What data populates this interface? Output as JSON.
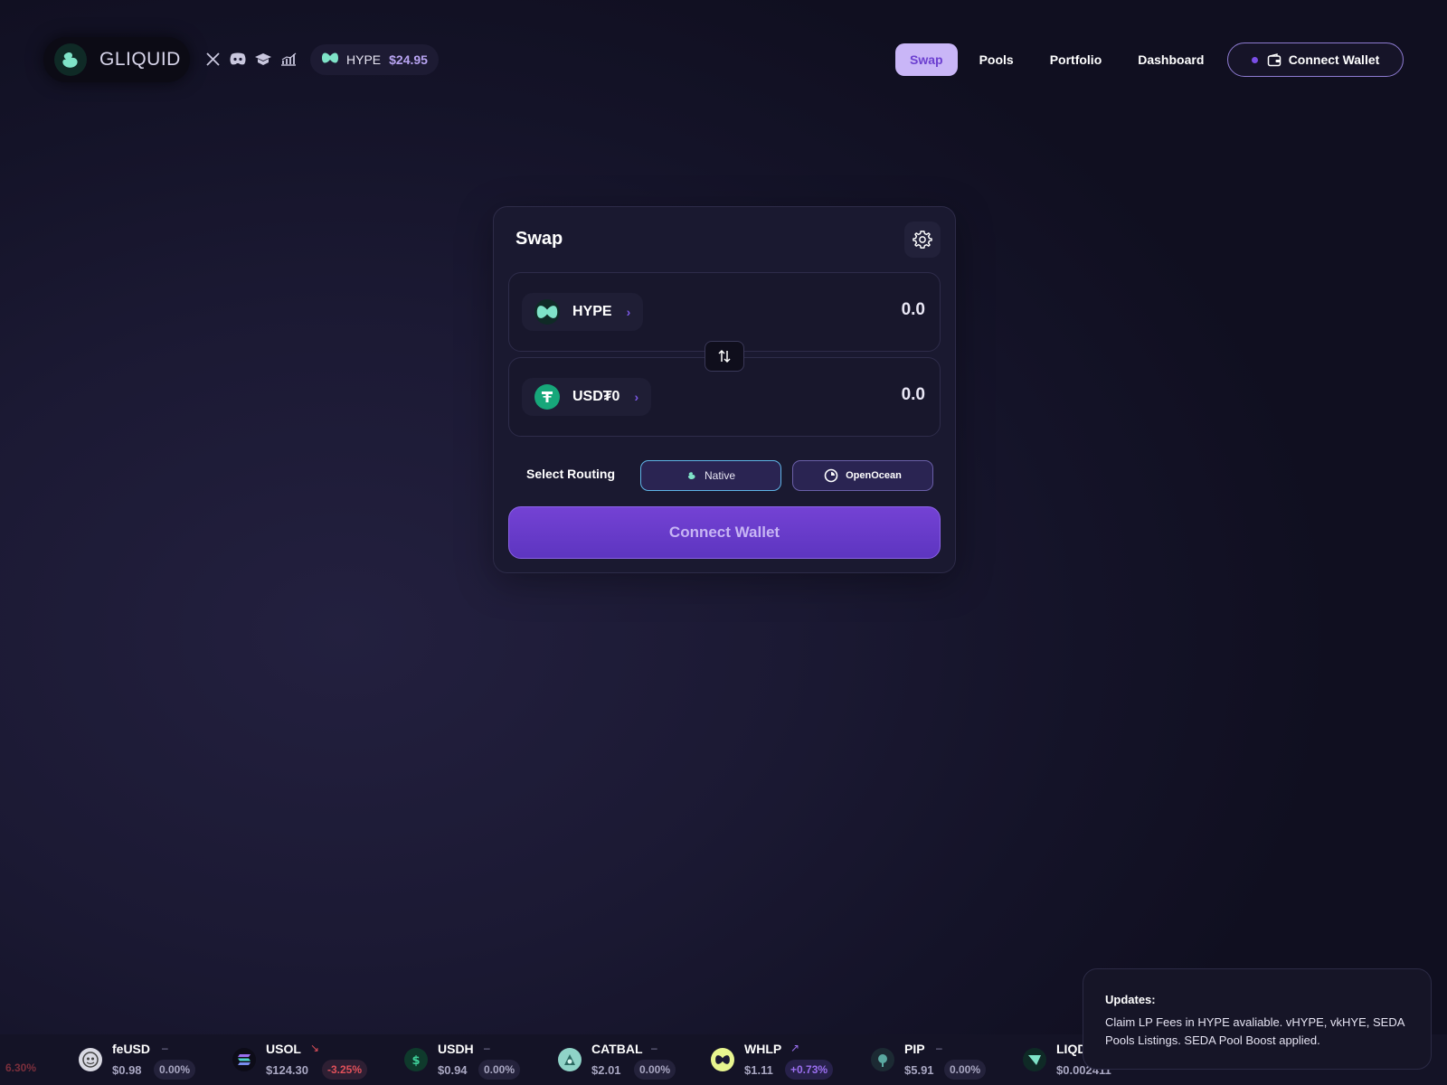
{
  "header": {
    "brand": "GLIQUID",
    "socials": [
      {
        "icon": "x-icon"
      },
      {
        "icon": "discord-icon"
      },
      {
        "icon": "docs-icon"
      },
      {
        "icon": "chart-icon"
      }
    ],
    "price_chip": {
      "token": "HYPE",
      "price": "$24.95"
    },
    "nav": [
      {
        "label": "Swap",
        "active": true
      },
      {
        "label": "Pools",
        "active": false
      },
      {
        "label": "Portfolio",
        "active": false
      },
      {
        "label": "Dashboard",
        "active": false
      }
    ],
    "connect_label": "Connect Wallet"
  },
  "swap": {
    "title": "Swap",
    "from": {
      "token": "HYPE",
      "amount": "0.0"
    },
    "to": {
      "token": "USD₮0",
      "amount": "0.0"
    },
    "routing_label": "Select Routing",
    "routes": [
      {
        "label": "Native",
        "selected": true
      },
      {
        "label": "OpenOcean",
        "selected": false
      }
    ],
    "connect_label": "Connect Wallet"
  },
  "updates": {
    "title": "Updates:",
    "body": "Claim LP Fees in HYPE avaliable. vHYPE, vkHYE, SEDA Pools Listings. SEDA Pool Boost applied."
  },
  "ticker": {
    "edge_change": "6.30%",
    "items": [
      {
        "symbol": "feUSD",
        "trend": "–",
        "price": "$0.98",
        "change": "0.00%",
        "direction": "neutral"
      },
      {
        "symbol": "USOL",
        "trend": "↘",
        "price": "$124.30",
        "change": "-3.25%",
        "direction": "down"
      },
      {
        "symbol": "USDH",
        "trend": "–",
        "price": "$0.94",
        "change": "0.00%",
        "direction": "neutral"
      },
      {
        "symbol": "CATBAL",
        "trend": "–",
        "price": "$2.01",
        "change": "0.00%",
        "direction": "neutral"
      },
      {
        "symbol": "WHLP",
        "trend": "↗",
        "price": "$1.11",
        "change": "+0.73%",
        "direction": "up"
      },
      {
        "symbol": "PIP",
        "trend": "–",
        "price": "$5.91",
        "change": "0.00%",
        "direction": "neutral"
      },
      {
        "symbol": "LIQD",
        "trend": "",
        "price": "$0.002411",
        "change": "",
        "direction": "down"
      }
    ]
  },
  "colors": {
    "accent": "#6d3fd3",
    "brand_mint": "#7fe3c8",
    "negative": "#e0505a",
    "positive": "#9b6ff0"
  }
}
